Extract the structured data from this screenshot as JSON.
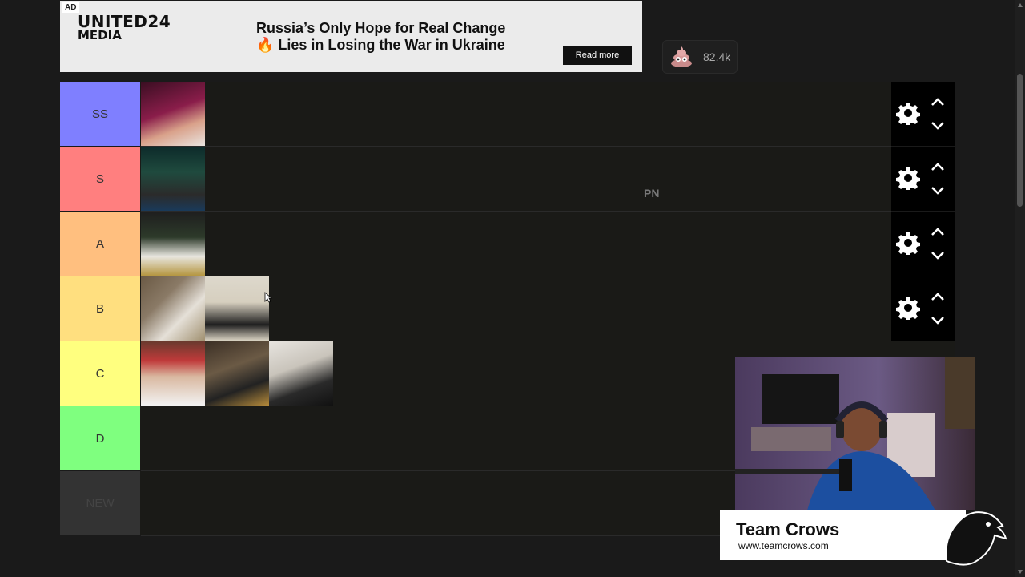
{
  "ad": {
    "tag": "AD",
    "brand_line1": "UNITED24",
    "brand_line2": "MEDIA",
    "headline_line1": "Russia’s Only Hope for Real Change",
    "headline_line2": "🔥 Lies in Losing the War in Ukraine",
    "cta": "Read more"
  },
  "reaction": {
    "icon": "poop-emoji-icon",
    "count": "82.4k"
  },
  "tiers": [
    {
      "label": "SS",
      "color": "#7f7fff",
      "items": 1
    },
    {
      "label": "S",
      "color": "#ff7f7f",
      "items": 1
    },
    {
      "label": "A",
      "color": "#ffbf7f",
      "items": 1
    },
    {
      "label": "B",
      "color": "#ffdf7f",
      "items": 2
    },
    {
      "label": "C",
      "color": "#ffff7f",
      "items": 3
    },
    {
      "label": "D",
      "color": "#7fff7f",
      "items": 0
    },
    {
      "label": "NEW",
      "color": "#333333",
      "items": 0
    }
  ],
  "watermark": "PN",
  "overlay": {
    "brand_name": "Team Crows",
    "brand_url": "www.teamcrows.com"
  }
}
